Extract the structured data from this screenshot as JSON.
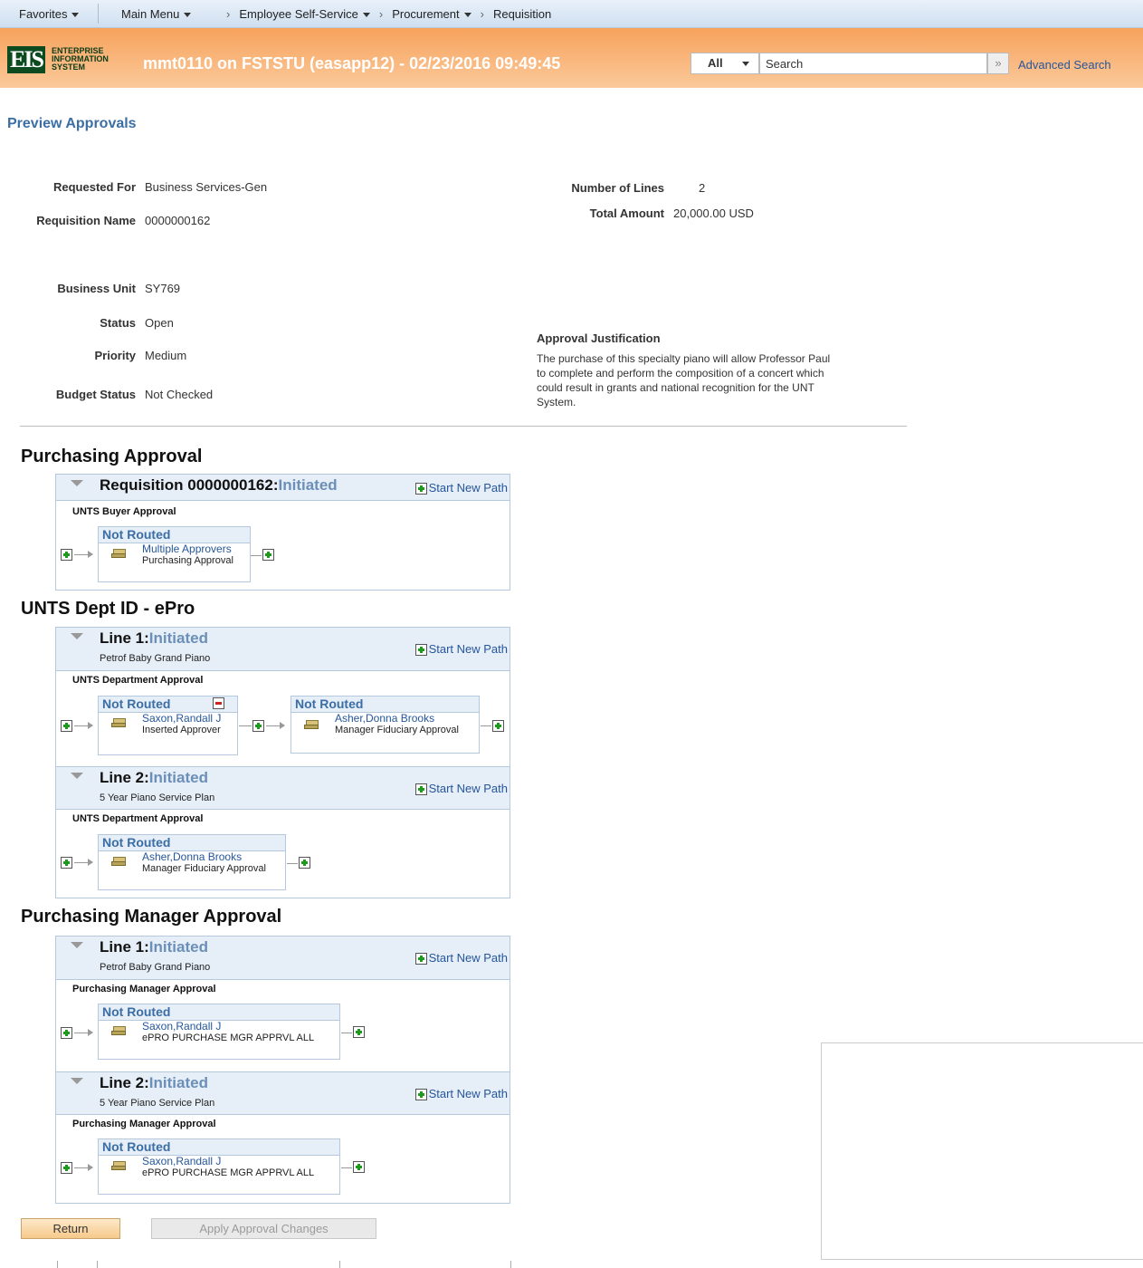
{
  "nav": {
    "favorites": "Favorites",
    "main_menu": "Main Menu",
    "crumbs": [
      "Employee Self-Service",
      "Procurement",
      "Requisition"
    ]
  },
  "header": {
    "logo_mark": "EIS",
    "logo_line1": "ENTERPRISE",
    "logo_line2": "INFORMATION",
    "logo_line3": "SYSTEM",
    "title": "mmt0110 on FSTSTU (easapp12) - 02/23/2016 09:49:45",
    "search_scope": "All",
    "search_placeholder": "Search",
    "search_go": "»",
    "advanced_search": "Advanced Search"
  },
  "page": {
    "title": "Preview Approvals",
    "fields": {
      "requested_for_label": "Requested For",
      "requested_for": "Business Services-Gen",
      "requisition_name_label": "Requisition Name",
      "requisition_name": "0000000162",
      "number_of_lines_label": "Number of Lines",
      "number_of_lines": "2",
      "total_amount_label": "Total Amount",
      "total_amount": "20,000.00 USD",
      "business_unit_label": "Business Unit",
      "business_unit": "SY769",
      "status_label": "Status",
      "status": "Open",
      "priority_label": "Priority",
      "priority": "Medium",
      "budget_status_label": "Budget Status",
      "budget_status": "Not Checked",
      "justification_label": "Approval Justification",
      "justification": "The purchase of this specialty piano will allow Professor Paul to complete and perform the composition of a concert which could result in grants and national recognition for the UNT System."
    }
  },
  "sections": {
    "s1": {
      "title": "Purchasing Approval",
      "box1": {
        "title": "Requisition 0000000162:",
        "status": "Initiated",
        "start_new_path": "Start New Path",
        "stage": "UNTS Buyer Approval",
        "steps": [
          {
            "state": "Not Routed",
            "approver": "Multiple Approvers",
            "role": "Purchasing Approval"
          }
        ]
      }
    },
    "s2": {
      "title": "UNTS Dept ID - ePro",
      "box1": {
        "title": "Line 1:",
        "status": "Initiated",
        "subtitle": "Petrof Baby Grand Piano",
        "start_new_path": "Start New Path",
        "stage": "UNTS Department Approval",
        "steps": [
          {
            "state": "Not Routed",
            "approver": "Saxon,Randall J",
            "role": "Inserted Approver"
          },
          {
            "state": "Not Routed",
            "approver": "Asher,Donna Brooks",
            "role": "Manager Fiduciary Approval"
          }
        ]
      },
      "box2": {
        "title": "Line 2:",
        "status": "Initiated",
        "subtitle": "5 Year Piano Service Plan",
        "start_new_path": "Start New Path",
        "stage": "UNTS Department Approval",
        "steps": [
          {
            "state": "Not Routed",
            "approver": "Asher,Donna Brooks",
            "role": "Manager Fiduciary Approval"
          }
        ]
      }
    },
    "s3": {
      "title": "Purchasing Manager Approval",
      "box1": {
        "title": "Line 1:",
        "status": "Initiated",
        "subtitle": "Petrof Baby Grand Piano",
        "start_new_path": "Start New Path",
        "stage": "Purchasing Manager Approval",
        "steps": [
          {
            "state": "Not Routed",
            "approver": "Saxon,Randall J",
            "role": "ePRO PURCHASE MGR APPRVL ALL"
          }
        ]
      },
      "box2": {
        "title": "Line 2:",
        "status": "Initiated",
        "subtitle": "5 Year Piano Service Plan",
        "start_new_path": "Start New Path",
        "stage": "Purchasing Manager Approval",
        "steps": [
          {
            "state": "Not Routed",
            "approver": "Saxon,Randall J",
            "role": "ePRO PURCHASE MGR APPRVL ALL"
          }
        ]
      }
    }
  },
  "buttons": {
    "return": "Return",
    "apply": "Apply Approval Changes"
  },
  "colors": {
    "header_orange": "#f7a25c",
    "link_blue": "#25569b",
    "status_blue": "#6b8fb8",
    "plus_green": "#1c9a1c",
    "minus_red": "#d02020"
  }
}
